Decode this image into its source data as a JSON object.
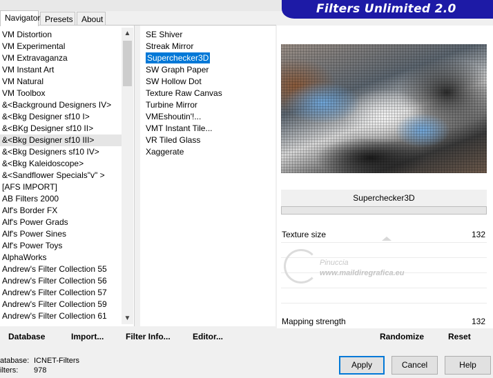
{
  "window": {
    "title": "Filters Unlimited 2.0"
  },
  "tabs": [
    "Navigator",
    "Presets",
    "About"
  ],
  "categories": [
    "VM Distortion",
    "VM Experimental",
    "VM Extravaganza",
    "VM Instant Art",
    "VM Natural",
    "VM Toolbox",
    "&<Background Designers IV>",
    "&<Bkg Designer sf10 I>",
    "&<BKg Designer sf10 II>",
    "&<Bkg Designer sf10 III>",
    "&<Bkg Designers sf10 IV>",
    "&<Bkg Kaleidoscope>",
    "&<Sandflower Specials\"v\" >",
    "[AFS IMPORT]",
    "AB Filters 2000",
    "Alf's Border FX",
    "Alf's Power Grads",
    "Alf's Power Sines",
    "Alf's Power Toys",
    "AlphaWorks",
    "Andrew's Filter Collection 55",
    "Andrew's Filter Collection 56",
    "Andrew's Filter Collection 57",
    "Andrew's Filter Collection 59",
    "Andrew's Filter Collection 61"
  ],
  "selected_category_index": 9,
  "filters": [
    "SE Shiver",
    "Streak Mirror",
    "Superchecker3D",
    "SW Graph Paper",
    "SW Hollow Dot",
    "Texture Raw Canvas",
    "Turbine Mirror",
    "VMEshoutin'!...",
    "VMT Instant Tile...",
    "VR Tiled Glass",
    "Xaggerate"
  ],
  "selected_filter_index": 2,
  "filter_title": "Superchecker3D",
  "controls": [
    {
      "label": "Texture size",
      "value": "132"
    },
    {
      "label": "Mapping strength",
      "value": "132"
    }
  ],
  "watermark": {
    "line1": "Pinuccia",
    "line2": "www.maildiregrafica.eu"
  },
  "toolbar": {
    "database": "Database",
    "import": "Import...",
    "filter_info": "Filter Info...",
    "editor": "Editor...",
    "randomize": "Randomize",
    "reset": "Reset"
  },
  "status": {
    "database_label": "atabase:",
    "database_value": "ICNET-Filters",
    "filters_label": "ilters:",
    "filters_value": "978"
  },
  "buttons": {
    "apply": "Apply",
    "cancel": "Cancel",
    "help": "Help"
  },
  "colors": {
    "banner": "#1d1aa6",
    "selection": "#0078d7",
    "apply_border": "#0078d7"
  },
  "scrollbar": {
    "up": "▲",
    "down": "▼"
  }
}
